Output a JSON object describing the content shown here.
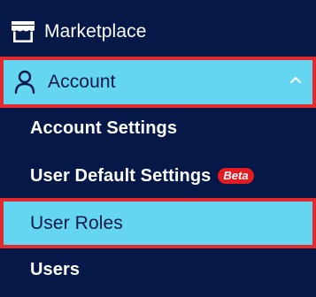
{
  "nav": {
    "marketplace": {
      "label": "Marketplace",
      "icon": "storefront-icon"
    },
    "account": {
      "label": "Account",
      "icon": "user-icon",
      "toggle_icon": "chevron-up-icon"
    },
    "account_items": [
      {
        "label": "Account Settings"
      },
      {
        "label": "User Default Settings",
        "badge": "Beta"
      },
      {
        "label": "User Roles"
      },
      {
        "label": "Users"
      }
    ]
  },
  "colors": {
    "background": "#061847",
    "active_bg": "#64d6f2",
    "highlight_border": "#e12b2e",
    "badge_bg": "#e31b23"
  }
}
